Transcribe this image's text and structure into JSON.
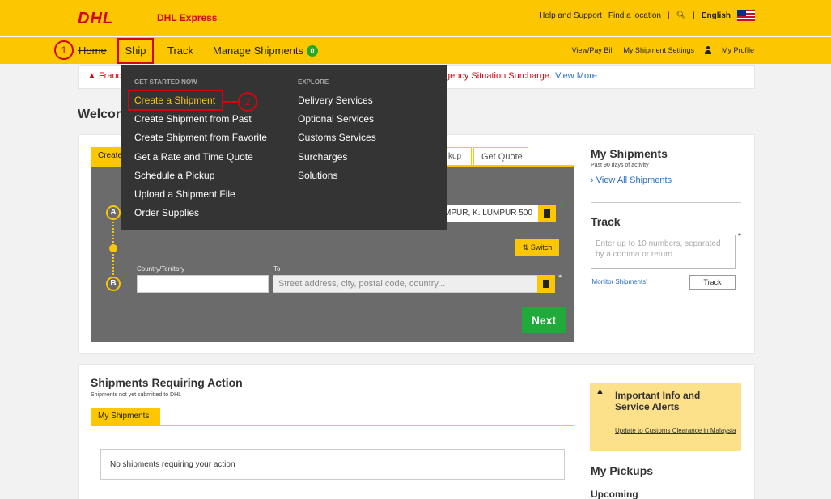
{
  "header": {
    "logo": "DHL",
    "brand": "DHL Express",
    "links": [
      "Help and Support",
      "Find a location"
    ],
    "search_icon": "search-icon",
    "language": "English",
    "flag_icon": "malaysia-flag-icon",
    "brand_colors": {
      "yellow": "#fcc600",
      "red": "#d40511"
    }
  },
  "nav": {
    "home": "Home",
    "ship": "Ship",
    "track": "Track",
    "manage": "Manage Shipments",
    "manage_count": "0",
    "right_links": [
      "View/Pay Bill",
      "My Shipment Settings",
      "My Profile"
    ]
  },
  "annotations": {
    "one": "1",
    "two": "2",
    "color": "#d40511"
  },
  "alert_strip": {
    "left": "Fraud",
    "right": "gency Situation Surcharge.",
    "link": "View More"
  },
  "welcome": "Welcor",
  "shipment_form": {
    "tab_create": "Create",
    "tab_pickup": "kup",
    "tab_quote": "Get Quote",
    "point_a": "A",
    "point_b": "B",
    "from_value": "MPUR, K. LUMPUR 500",
    "switch_label": "Switch",
    "country_label": "Country/Territory",
    "to_label": "To",
    "to_placeholder": "Street address, city, postal code, country...",
    "required": "*",
    "next": "Next"
  },
  "my_shipments": {
    "title": "My Shipments",
    "subtitle": "Past 90 days of activity",
    "link": "View All Shipments"
  },
  "track_panel": {
    "title": "Track",
    "placeholder": "Enter up to 10 numbers, separated by a comma or return",
    "required": "*",
    "monitor_link": "'Monitor Shipments'",
    "button": "Track"
  },
  "shipments_requiring_action": {
    "title": "Shipments Requiring Action",
    "subtitle": "Shipments not yet submitted to DHL",
    "tab": "My Shipments",
    "empty": "No shipments requiring your action"
  },
  "alerts_box": {
    "title": "Important Info and Service Alerts",
    "link": "Update to Customs Clearance in Malaysia"
  },
  "pickups": {
    "title": "My Pickups",
    "upcoming": "Upcoming"
  },
  "ship_menu": {
    "heading_left": "GET STARTED NOW",
    "heading_right": "EXPLORE",
    "left_items": [
      "Create a Shipment",
      "Create Shipment from Past",
      "Create Shipment from Favorite",
      "Get a Rate and Time Quote",
      "Schedule a Pickup",
      "Upload a Shipment File",
      "Order Supplies"
    ],
    "right_items": [
      "Delivery Services",
      "Optional Services",
      "Customs Services",
      "Surcharges",
      "Solutions"
    ]
  }
}
